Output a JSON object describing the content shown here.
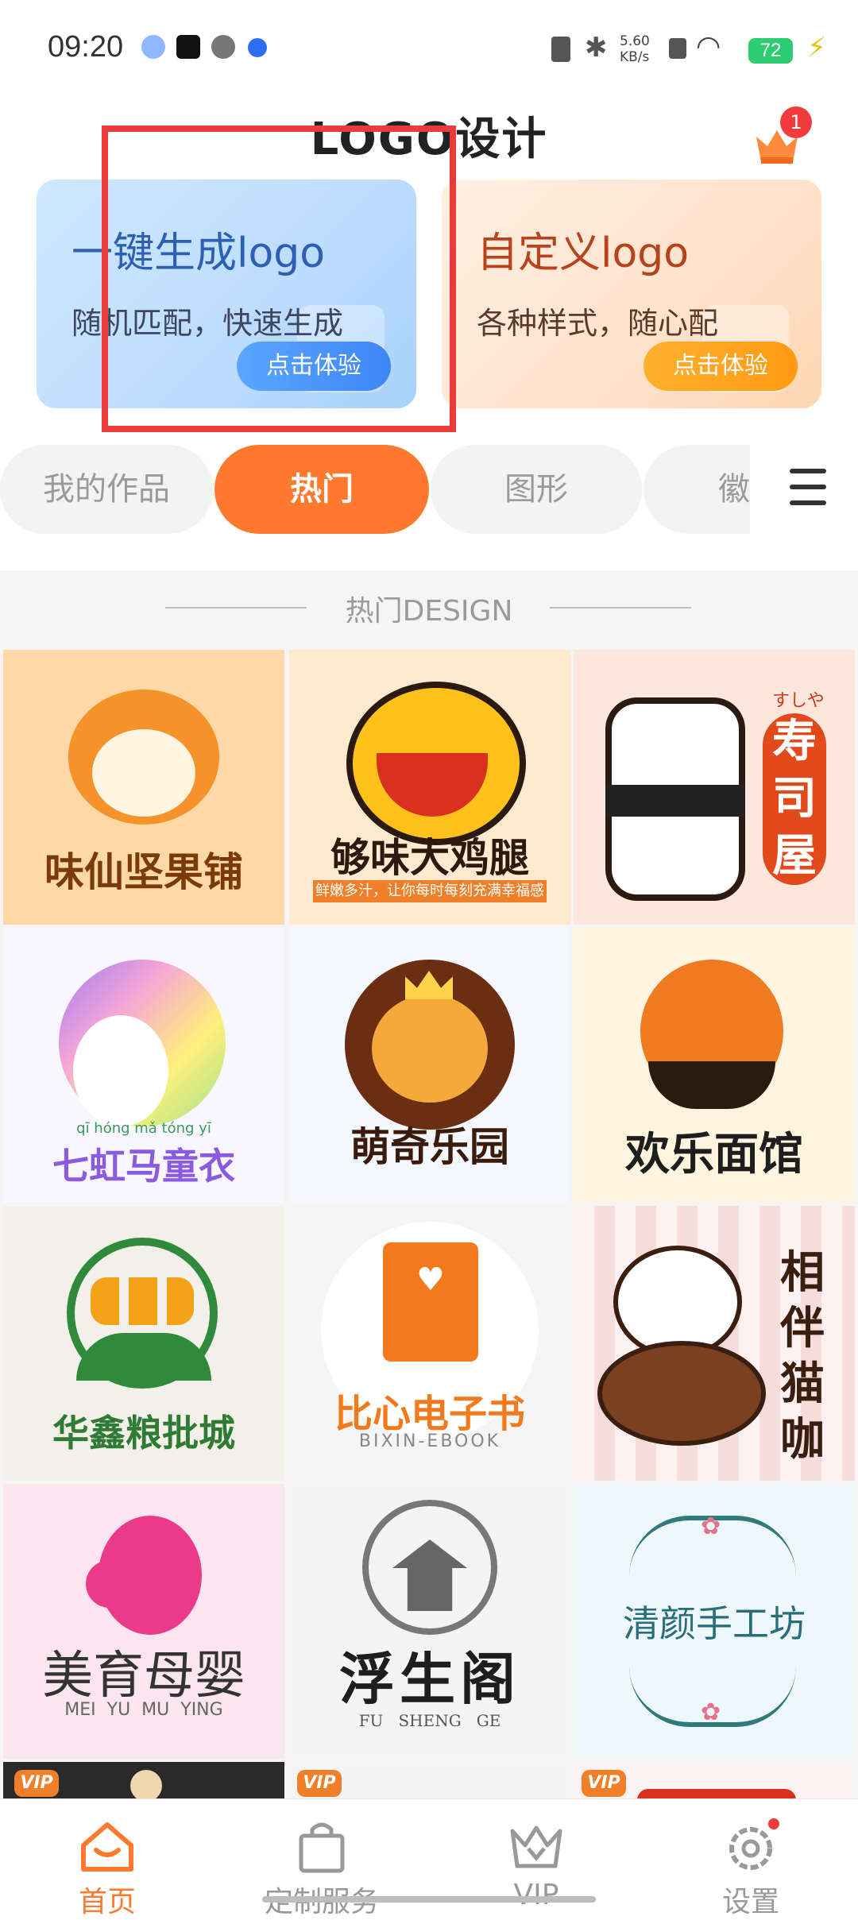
{
  "status_bar": {
    "time": "09:20",
    "net_speed": "5.60 KB/s",
    "battery": "72"
  },
  "header": {
    "title": "LOGO设计",
    "notification_count": "1"
  },
  "promos": [
    {
      "title": "一键生成logo",
      "subtitle": "随机匹配，快速生成",
      "button": "点击体验"
    },
    {
      "title": "自定义logo",
      "subtitle": "各种样式，随心配",
      "button": "点击体验"
    }
  ],
  "tabs": [
    "我的作品",
    "热门",
    "图形",
    "徽"
  ],
  "active_tab": "热门",
  "section": {
    "title": "热门DESIGN"
  },
  "grid": [
    {
      "name": "味仙坚果铺",
      "bg": "#ffd8a8"
    },
    {
      "name": "够味大鸡腿",
      "sub": "鲜嫩多汁，让你每时每刻充满幸福感",
      "bg": "#ffe9cf"
    },
    {
      "name": "寿司屋",
      "small": "すしや",
      "bg": "#fde6dc"
    },
    {
      "name": "七虹马童衣",
      "pinyin": "qī hóng mǎ tóng yī",
      "bg": "#f8f6ff"
    },
    {
      "name": "萌奇乐园",
      "bg": "#f4f7fb"
    },
    {
      "name": "欢乐面馆",
      "bg": "#fff4de"
    },
    {
      "name": "华鑫粮批城",
      "bg": "#f2f0e8"
    },
    {
      "name": "比心电子书",
      "sub": "BIXIN-EBOOK",
      "bg": "#f5f5f5"
    },
    {
      "name": "相伴猫咖",
      "bg": "#fdf1f1"
    },
    {
      "name": "美育母婴",
      "sub": "MEI  YU  MU  YING",
      "bg": "#fbe6ef"
    },
    {
      "name": "浮生阁",
      "sub": "FU   SHENG   GE",
      "bg": "#f4f4f4"
    },
    {
      "name": "清颜手工坊",
      "bg": "#eef8fb"
    }
  ],
  "vip_label": "VIP",
  "bottom_nav": [
    {
      "label": "首页",
      "active": true
    },
    {
      "label": "定制服务",
      "active": false
    },
    {
      "label": "VIP",
      "active": false
    },
    {
      "label": "设置",
      "active": false
    }
  ],
  "colors": {
    "accent": "#ff7a2f",
    "blue": "#3e86f5",
    "highlight_box": "#ea3b3b"
  }
}
